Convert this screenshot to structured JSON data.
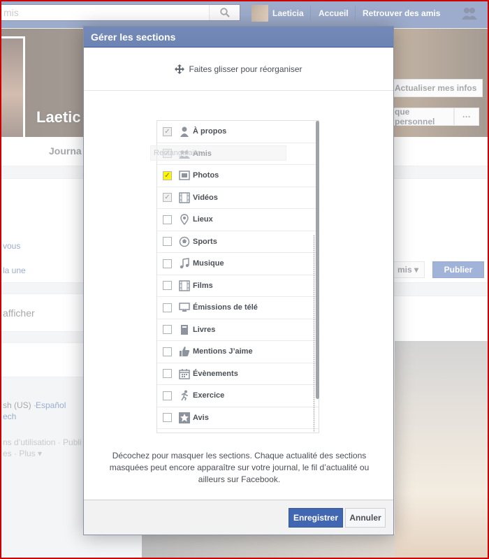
{
  "topbar": {
    "search_value": "mis",
    "user_name": "Laeticia",
    "home_label": "Accueil",
    "find_friends_label": "Retrouver des amis"
  },
  "profile": {
    "name_partial": "Laetic",
    "update_info_label": "Actualiser mes infos",
    "journal_button_partial": "que personnel",
    "more_label": "···",
    "timeline_tab": "Journa"
  },
  "left_column": {
    "link_vous": "vous",
    "link_une": "la une",
    "afficher": "afficher",
    "lang_english": "sh (US) ·",
    "lang_espanol": "Español",
    "lang_czech": "ech",
    "footer_conditions": "ns d’utilisation · Publi",
    "footer_plus": "es · Plus ▾"
  },
  "composer": {
    "audience_label": "mis ▾",
    "publish_label": "Publier"
  },
  "dialog": {
    "title": "Gérer les sections",
    "drag_hint": "Faites glisser pour réorganiser",
    "ghost_hint": "Rectangulaire",
    "sections": [
      {
        "label": "À propos",
        "checked": "✓",
        "icon": "person-icon"
      },
      {
        "label": "Amis",
        "checked": "✓",
        "icon": "friends-icon"
      },
      {
        "label": "Photos",
        "checked": "✓",
        "icon": "photos-icon"
      },
      {
        "label": "Vidéos",
        "checked": "✓",
        "icon": "film-icon"
      },
      {
        "label": "Lieux",
        "checked": "",
        "icon": "map-pin-icon"
      },
      {
        "label": "Sports",
        "checked": "",
        "icon": "sports-icon"
      },
      {
        "label": "Musique",
        "checked": "",
        "icon": "music-icon"
      },
      {
        "label": "Films",
        "checked": "",
        "icon": "film-icon"
      },
      {
        "label": "Émissions de télé",
        "checked": "",
        "icon": "tv-icon"
      },
      {
        "label": "Livres",
        "checked": "",
        "icon": "book-icon"
      },
      {
        "label": "Mentions J’aime",
        "checked": "",
        "icon": "thumbs-up-icon"
      },
      {
        "label": "Évènements",
        "checked": "",
        "icon": "calendar-icon"
      },
      {
        "label": "Exercice",
        "checked": "",
        "icon": "running-icon"
      },
      {
        "label": "Avis",
        "checked": "",
        "icon": "star-icon"
      }
    ],
    "note": "Décochez pour masquer les sections. Chaque actualité des sections masquées peut encore apparaître sur votre journal, le fil d’actualité ou ailleurs sur Facebook.",
    "save_label": "Enregistrer",
    "cancel_label": "Annuler"
  },
  "colors": {
    "brand": "#3b5998",
    "button_blue": "#4267b2",
    "highlight": "#fff600",
    "frame": "#cc0000"
  }
}
